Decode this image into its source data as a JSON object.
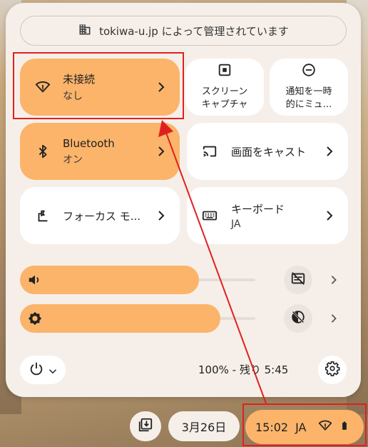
{
  "managed_banner": {
    "text": "tokiwa-u.jp によって管理されています"
  },
  "tiles": {
    "network": {
      "title": "未接続",
      "subtitle": "なし"
    },
    "screen_capture": {
      "line1": "スクリーン",
      "line2": "キャプチャ"
    },
    "do_not_disturb": {
      "line1": "通知を一時",
      "line2": "的にミュ..."
    },
    "bluetooth": {
      "title": "Bluetooth",
      "subtitle": "オン"
    },
    "cast": {
      "title": "画面をキャスト"
    },
    "focus": {
      "title": "フォーカス モ..."
    },
    "keyboard": {
      "title": "キーボード",
      "subtitle": "JA"
    }
  },
  "sliders": {
    "volume": {
      "level": 0.76
    },
    "brightness": {
      "level": 0.85
    }
  },
  "footer": {
    "battery": "100% - 残り 5:45"
  },
  "shelf": {
    "date": "3月26日",
    "time": "15:02",
    "ime": "JA"
  },
  "colors": {
    "accent": "#fbb46a",
    "panel": "#f6efe9",
    "annotation": "#e02020"
  }
}
